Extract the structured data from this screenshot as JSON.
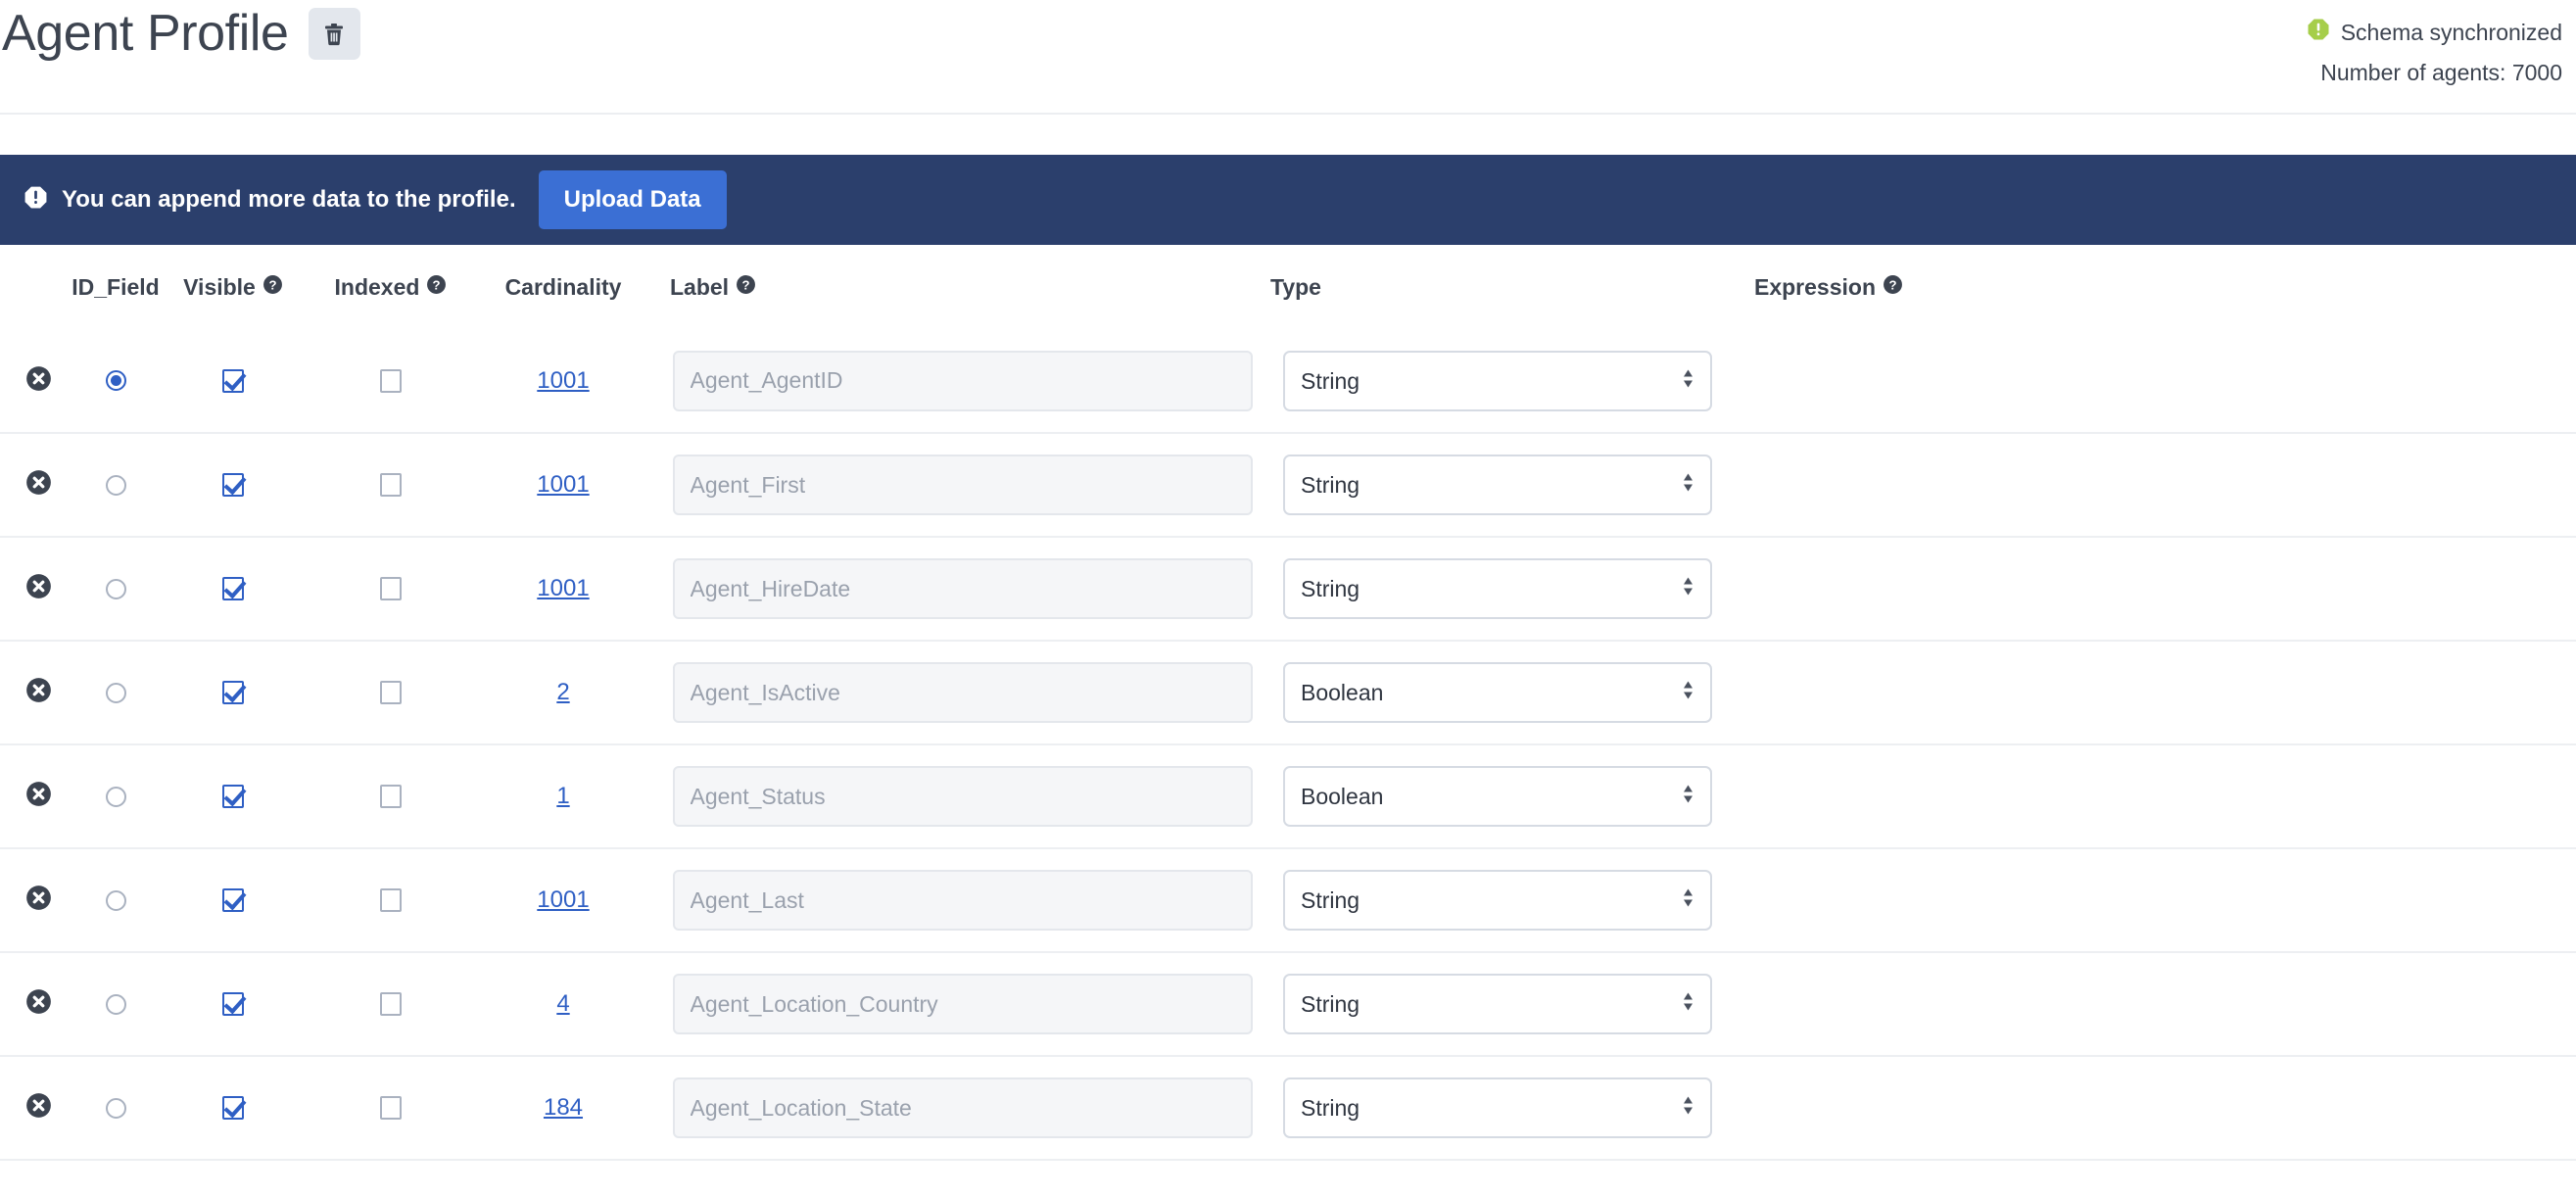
{
  "header": {
    "title": "Agent Profile",
    "delete_icon": "trash-icon",
    "status_icon": "alert-octagon-icon",
    "status_text": "Schema synchronized",
    "agent_count_text": "Number of agents: 7000"
  },
  "banner": {
    "info_icon": "info-octagon-icon",
    "message": "You can append more data to the profile.",
    "upload_label": "Upload Data",
    "bg_color": "#2b3f6c",
    "button_color": "#3b6fd4"
  },
  "table": {
    "columns": {
      "delete": "",
      "id_field": "ID_Field",
      "visible": "Visible",
      "indexed": "Indexed",
      "cardinality": "Cardinality",
      "label": "Label",
      "type": "Type",
      "expression": "Expression"
    },
    "rows": [
      {
        "id_selected": true,
        "visible": true,
        "indexed": false,
        "cardinality": "1001",
        "label": "Agent_AgentID",
        "type": "String",
        "expression": ""
      },
      {
        "id_selected": false,
        "visible": true,
        "indexed": false,
        "cardinality": "1001",
        "label": "Agent_First",
        "type": "String",
        "expression": ""
      },
      {
        "id_selected": false,
        "visible": true,
        "indexed": false,
        "cardinality": "1001",
        "label": "Agent_HireDate",
        "type": "String",
        "expression": ""
      },
      {
        "id_selected": false,
        "visible": true,
        "indexed": false,
        "cardinality": "2",
        "label": "Agent_IsActive",
        "type": "Boolean",
        "expression": ""
      },
      {
        "id_selected": false,
        "visible": true,
        "indexed": false,
        "cardinality": "1",
        "label": "Agent_Status",
        "type": "Boolean",
        "expression": ""
      },
      {
        "id_selected": false,
        "visible": true,
        "indexed": false,
        "cardinality": "1001",
        "label": "Agent_Last",
        "type": "String",
        "expression": ""
      },
      {
        "id_selected": false,
        "visible": true,
        "indexed": false,
        "cardinality": "4",
        "label": "Agent_Location_Country",
        "type": "String",
        "expression": ""
      },
      {
        "id_selected": false,
        "visible": true,
        "indexed": false,
        "cardinality": "184",
        "label": "Agent_Location_State",
        "type": "String",
        "expression": ""
      }
    ],
    "type_options": [
      "String",
      "Boolean"
    ]
  },
  "colors": {
    "link": "#2f5fc4",
    "accent": "#2f5fc4",
    "status_green": "#a6ce4a",
    "text": "#3d4450"
  }
}
